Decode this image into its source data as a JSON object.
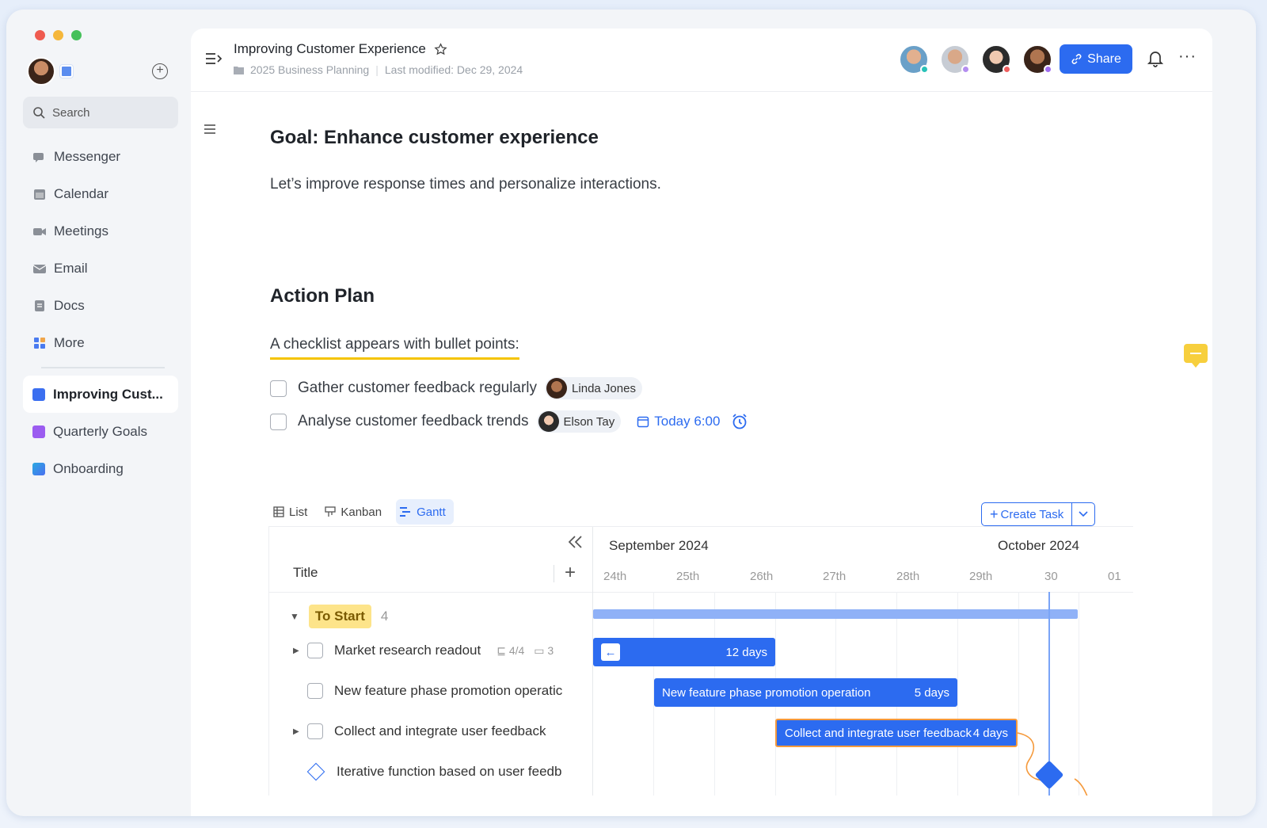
{
  "window": {
    "colors": {
      "close": "#ef5b50",
      "minimize": "#f5b73b",
      "zoom": "#45c05a"
    }
  },
  "sidebar": {
    "search_placeholder": "Search",
    "nav": [
      {
        "label": "Messenger",
        "icon": "chat-icon"
      },
      {
        "label": "Calendar",
        "icon": "calendar-icon"
      },
      {
        "label": "Meetings",
        "icon": "video-icon"
      },
      {
        "label": "Email",
        "icon": "mail-icon"
      },
      {
        "label": "Docs",
        "icon": "docs-icon"
      },
      {
        "label": "More",
        "icon": "grid-icon"
      }
    ],
    "docs": [
      {
        "label": "Improving Cust...",
        "color": "#3b6ff0",
        "active": true
      },
      {
        "label": "Quarterly Goals",
        "color": "#9b5cf0",
        "active": false
      },
      {
        "label": "Onboarding",
        "color": "#2aa9e0",
        "active": false
      }
    ]
  },
  "header": {
    "title": "Improving Customer Experience",
    "folder": "2025 Business Planning",
    "last_modified": "Last modified: Dec 29, 2024",
    "share_label": "Share"
  },
  "doc": {
    "goal_heading": "Goal: Enhance customer experience",
    "goal_text": "Let’s improve response times and personalize interactions.",
    "plan_heading": "Action Plan",
    "checklist_intro": "A checklist appears with bullet points:",
    "todos": [
      {
        "text": "Gather customer feedback regularly",
        "assignee": "Linda Jones"
      },
      {
        "text": "Analyse customer feedback trends",
        "assignee": "Elson Tay",
        "due": "Today 6:00"
      }
    ]
  },
  "views": {
    "tabs": [
      "List",
      "Kanban",
      "Gantt"
    ],
    "active": "Gantt",
    "create_label": "Create Task"
  },
  "gantt": {
    "title_header": "Title",
    "months": [
      "September 2024",
      "October 2024"
    ],
    "days": [
      "24th",
      "25th",
      "26th",
      "27th",
      "28th",
      "29th",
      "30",
      "01"
    ],
    "group": {
      "label": "To Start",
      "count": "4"
    },
    "tasks": [
      {
        "title": "Market research readout",
        "subtasks": "4/4",
        "comments": "3",
        "bar_label": "12 days"
      },
      {
        "title": "New feature phase promotion operatic",
        "bar_label": "New feature phase promotion operation",
        "bar_days": "5 days"
      },
      {
        "title": "Collect and integrate user feedback",
        "bar_label": "Collect and integrate user feedback",
        "bar_days": "4 days"
      },
      {
        "title": "Iterative function based on user feedb"
      }
    ]
  }
}
